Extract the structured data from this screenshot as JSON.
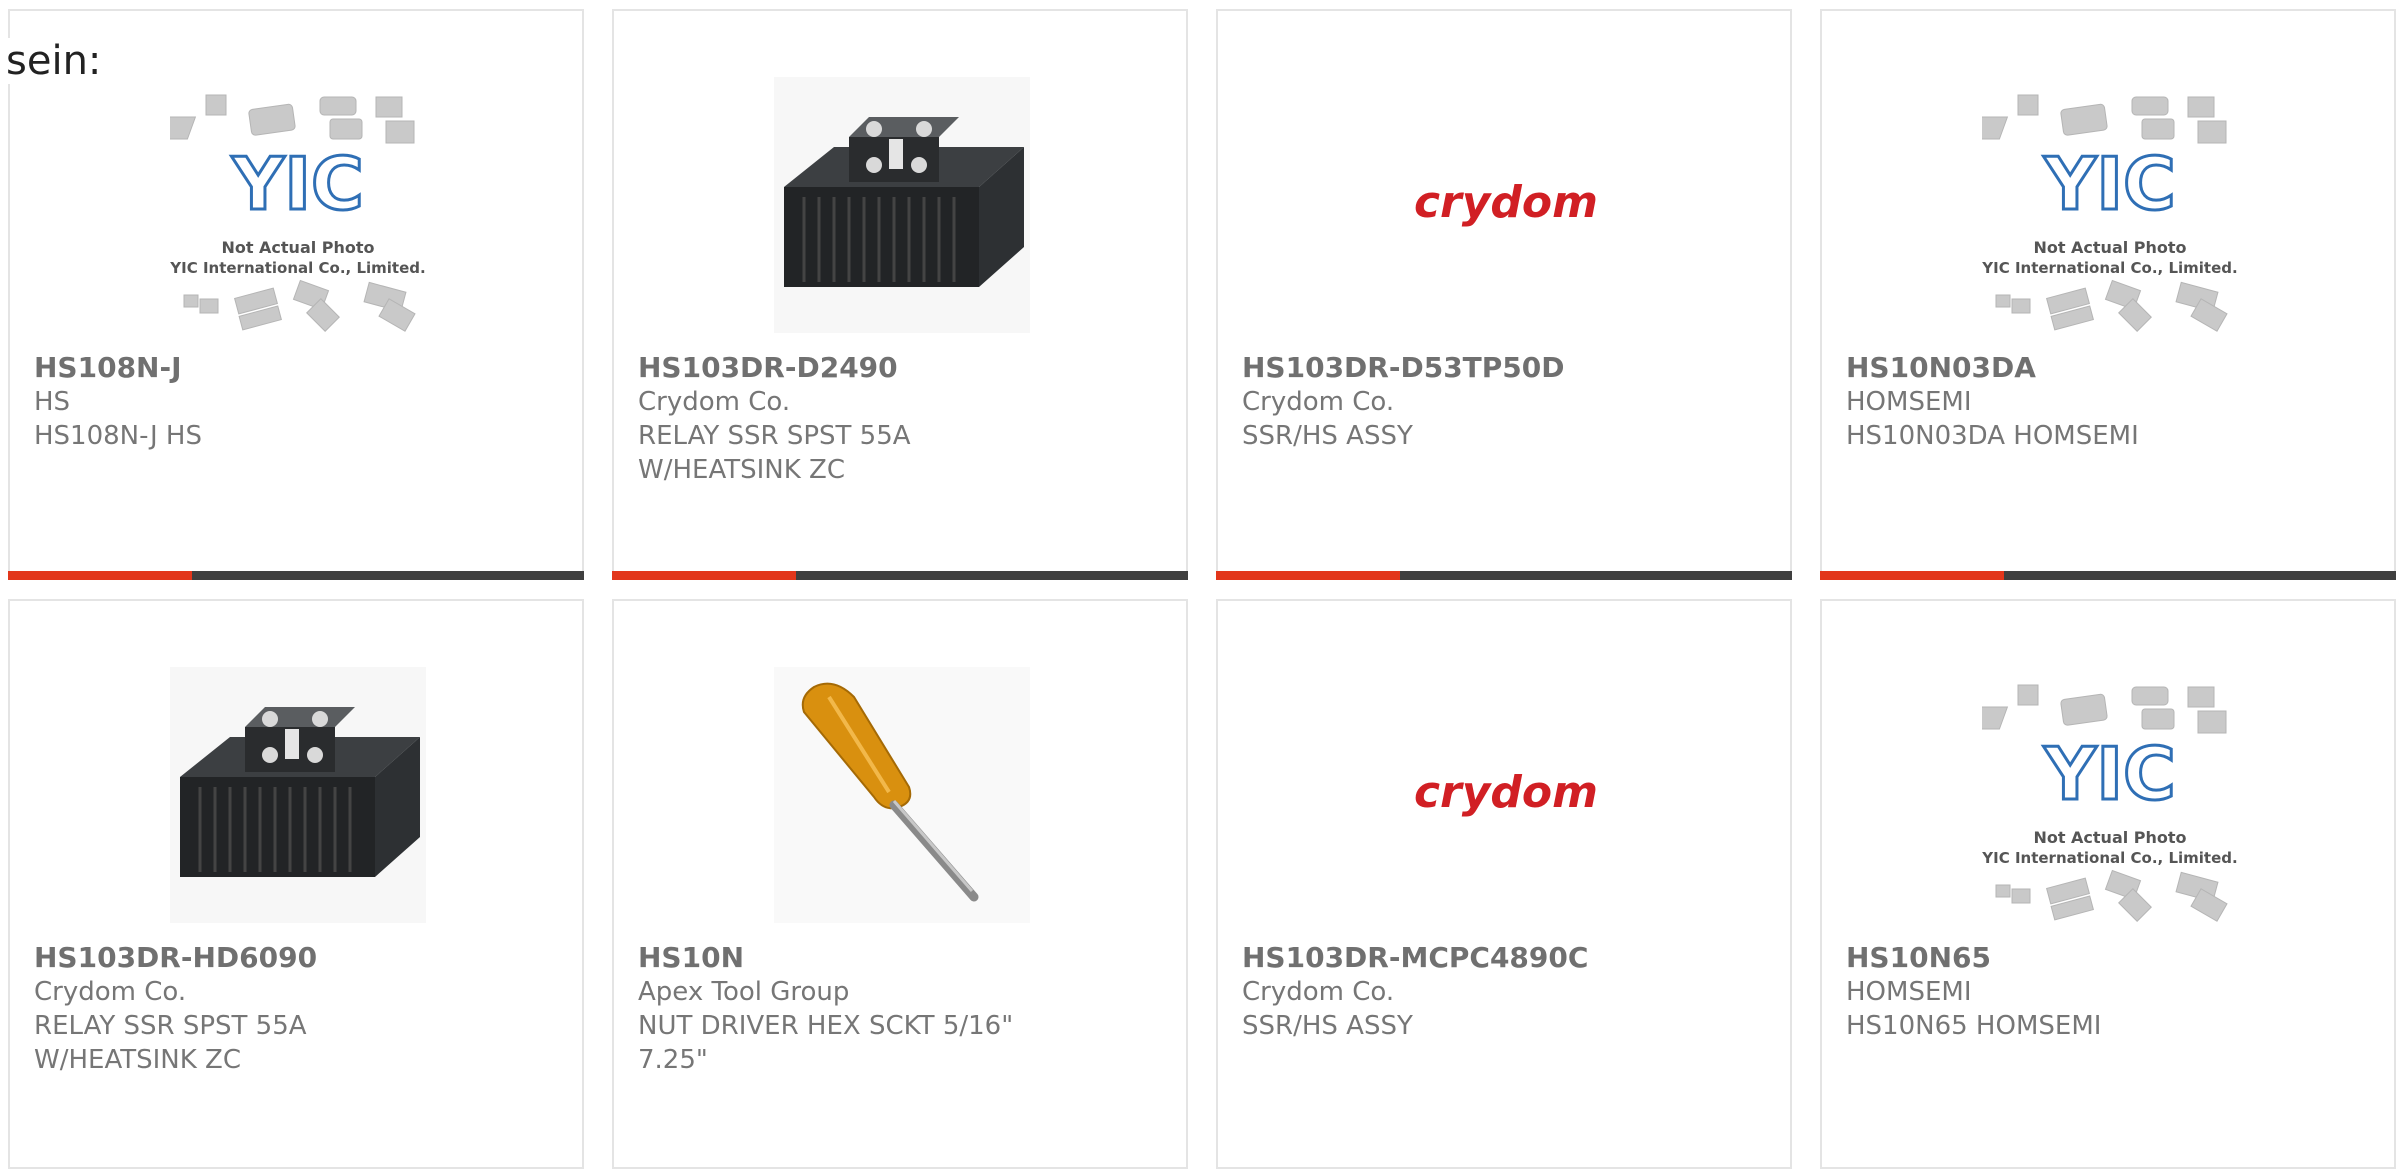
{
  "intro_text": "sein:",
  "products": [
    {
      "part": "HS108N-J",
      "maker": "HS",
      "desc1": "HS108N-J HS",
      "desc2": "",
      "image": "yic-placeholder"
    },
    {
      "part": "HS103DR-D2490",
      "maker": "Crydom Co.",
      "desc1": "RELAY SSR SPST 55A",
      "desc2": "W/HEATSINK ZC",
      "image": "ssr-heatsink"
    },
    {
      "part": "HS103DR-D53TP50D",
      "maker": "Crydom Co.",
      "desc1": "SSR/HS ASSY",
      "desc2": "",
      "image": "crydom-logo"
    },
    {
      "part": "HS10N03DA",
      "maker": "HOMSEMI",
      "desc1": "HS10N03DA HOMSEMI",
      "desc2": "",
      "image": "yic-placeholder"
    },
    {
      "part": "HS103DR-HD6090",
      "maker": "Crydom Co.",
      "desc1": "RELAY SSR SPST 55A",
      "desc2": "W/HEATSINK ZC",
      "image": "ssr-heatsink"
    },
    {
      "part": "HS10N",
      "maker": "Apex Tool Group",
      "desc1": "NUT DRIVER HEX SCKT 5/16\"",
      "desc2": "7.25\"",
      "image": "nut-driver"
    },
    {
      "part": "HS103DR-MCPC4890C",
      "maker": "Crydom Co.",
      "desc1": "SSR/HS ASSY",
      "desc2": "",
      "image": "crydom-logo"
    },
    {
      "part": "HS10N65",
      "maker": "HOMSEMI",
      "desc1": "HS10N65 HOMSEMI",
      "desc2": "",
      "image": "yic-placeholder"
    }
  ],
  "placeholder": {
    "logo": "YIC",
    "line1": "Not Actual Photo",
    "line2": "YIC International Co., Limited."
  },
  "brand_logo_text": "crydom",
  "colors": {
    "accent": "#e2361b",
    "bar": "#3f3f3f",
    "text": "#767676",
    "yic_blue": "#2f6fb5",
    "crydom_red": "#d11f24"
  }
}
